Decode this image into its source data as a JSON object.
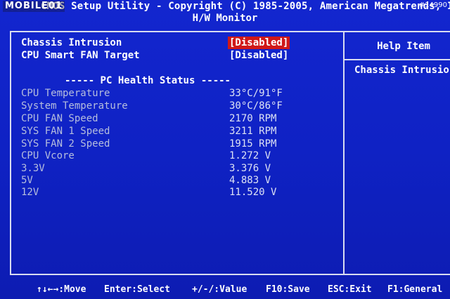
{
  "watermark": {
    "logo": "MOBILE01",
    "id": "#14990"
  },
  "header": {
    "utility_title": "CMOS Setup Utility - Copyright (C) 1985-2005, American Megatrends, Inc.",
    "page_title": "H/W Monitor"
  },
  "settings": [
    {
      "label": "Chassis Intrusion",
      "value": "[Disabled]",
      "selected": true
    },
    {
      "label": "CPU Smart FAN Target",
      "value": "[Disabled]",
      "selected": false
    }
  ],
  "health": {
    "heading": "----- PC Health Status -----",
    "items": [
      {
        "label": "CPU Temperature",
        "value": "33°C/91°F"
      },
      {
        "label": "System Temperature",
        "value": "30°C/86°F"
      },
      {
        "label": "CPU FAN Speed",
        "value": "2170 RPM"
      },
      {
        "label": "SYS FAN 1 Speed",
        "value": "3211 RPM"
      },
      {
        "label": "SYS FAN 2 Speed",
        "value": "1915 RPM"
      },
      {
        "label": "CPU Vcore",
        "value": "1.272 V"
      },
      {
        "label": "3.3V",
        "value": "3.376 V"
      },
      {
        "label": "5V",
        "value": "4.883 V"
      },
      {
        "label": "12V",
        "value": "11.520 V"
      }
    ]
  },
  "help": {
    "title": "Help Item",
    "text": "Chassis Intrusion"
  },
  "footer": {
    "move": "↑↓←→:Move",
    "enter": "Enter:Select",
    "value": "+/-/:Value",
    "save": "F10:Save",
    "exit": "ESC:Exit",
    "general": "F1:General"
  },
  "colors": {
    "background": "#1326cf",
    "selected_value": "#d01818",
    "status_label": "#b6bedd"
  }
}
